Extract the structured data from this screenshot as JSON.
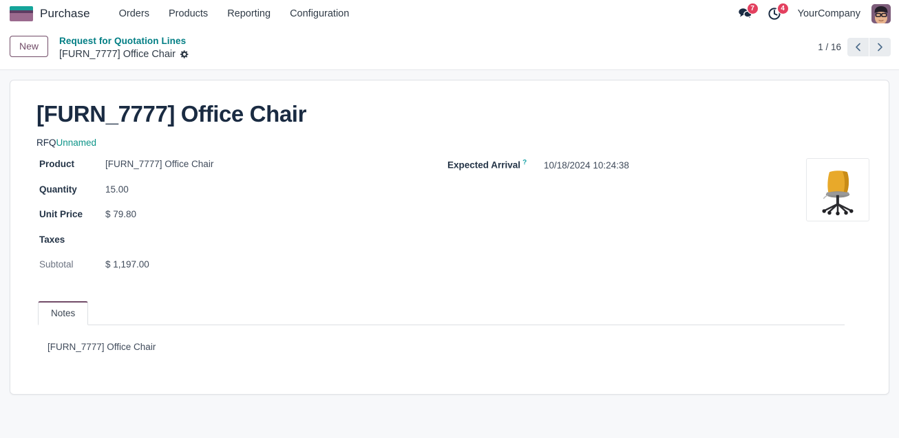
{
  "navbar": {
    "app_name": "Purchase",
    "logo_icon": "odoo-logo-bars",
    "menu": [
      {
        "label": "Orders"
      },
      {
        "label": "Products"
      },
      {
        "label": "Reporting"
      },
      {
        "label": "Configuration"
      }
    ],
    "messages_icon": "messages-icon",
    "messages_count": "7",
    "activities_icon": "clock-activity-icon",
    "activities_count": "4",
    "company": "YourCompany",
    "avatar_icon": "user-avatar"
  },
  "control_panel": {
    "new_label": "New",
    "breadcrumb_parent": "Request for Quotation Lines",
    "breadcrumb_current": "[FURN_7777] Office Chair",
    "gear_icon": "gear-icon",
    "pager_value": "1 / 16",
    "prev_icon": "chevron-left-icon",
    "next_icon": "chevron-right-icon"
  },
  "record": {
    "title": "[FURN_7777] Office Chair",
    "rfq_label": "RFQ",
    "rfq_value": "Unnamed",
    "image_icon": "office-chair-image",
    "fields": [
      {
        "label": "Product",
        "value": "[FURN_7777] Office Chair",
        "readonly": false
      },
      {
        "label": "Quantity",
        "value": "15.00",
        "readonly": false
      },
      {
        "label": "Unit Price",
        "value": "$ 79.80",
        "readonly": false
      },
      {
        "label": "Taxes",
        "value": "",
        "readonly": false
      },
      {
        "label": "Subtotal",
        "value": "$ 1,197.00",
        "readonly": true
      }
    ],
    "expected_arrival_label": "Expected Arrival",
    "expected_arrival_help": "?",
    "expected_arrival_value": "10/18/2024 10:24:38"
  },
  "notebook": {
    "tabs": [
      {
        "label": "Notes",
        "active": true
      }
    ],
    "notes_content": "[FURN_7777] Office Chair"
  },
  "colors": {
    "primary": "#714B67",
    "link": "#017e84",
    "badge": "#e3405f",
    "page_bg": "#f7f8fa"
  }
}
